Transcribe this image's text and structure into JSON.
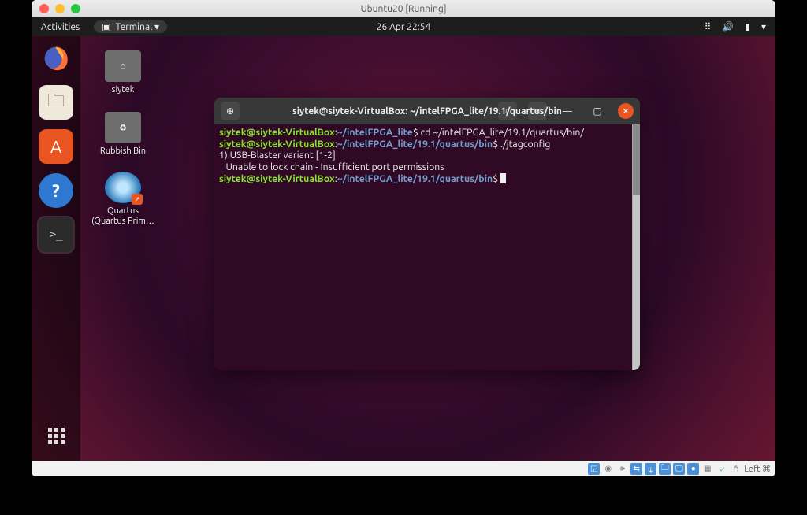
{
  "mac": {
    "title": "Ubuntu20 [Running]",
    "lights": {
      "red": "#ff5f57",
      "yellow": "#febc2e",
      "green": "#28c840"
    }
  },
  "top_bar": {
    "activities": "Activities",
    "terminal_menu": "Terminal ▾",
    "datetime": "26 Apr  22:54"
  },
  "dock": {
    "firefox": "firefox-icon",
    "files": "files-icon",
    "software": "software-icon",
    "help": "help-icon",
    "terminal": "terminal-icon",
    "apps": "apps-grid-icon"
  },
  "desktop_icons": {
    "home": {
      "label": "siytek"
    },
    "trash": {
      "label": "Rubbish Bin"
    },
    "quartus": {
      "label": "Quartus (Quartus Prim…"
    }
  },
  "terminal": {
    "title": "siytek@siytek-VirtualBox: ~/intelFPGA_lite/19.1/quartus/bin",
    "lines": [
      {
        "user": "siytek@siytek-VirtualBox",
        "colon": ":",
        "path": "~/intelFPGA_lite",
        "dollar": "$ ",
        "cmd": "cd ~/intelFPGA_lite/19.1/quartus/bin/"
      },
      {
        "user": "siytek@siytek-VirtualBox",
        "colon": ":",
        "path": "~/intelFPGA_lite/19.1/quartus/bin",
        "dollar": "$ ",
        "cmd": "./jtagconfig"
      },
      {
        "plain": "1) USB-Blaster variant [1-2]"
      },
      {
        "plain": "   Unable to lock chain - Insufficient port permissions"
      },
      {
        "user": "siytek@siytek-VirtualBox",
        "colon": ":",
        "path": "~/intelFPGA_lite/19.1/quartus/bin",
        "dollar": "$ ",
        "cmd": ""
      }
    ],
    "buttons": {
      "new_tab": "⊕",
      "search": "⌕",
      "menu": "≡",
      "minimize": "—",
      "maximize": "▢",
      "close": "✕"
    }
  },
  "status_bar": {
    "right_text": "Left ⌘"
  }
}
